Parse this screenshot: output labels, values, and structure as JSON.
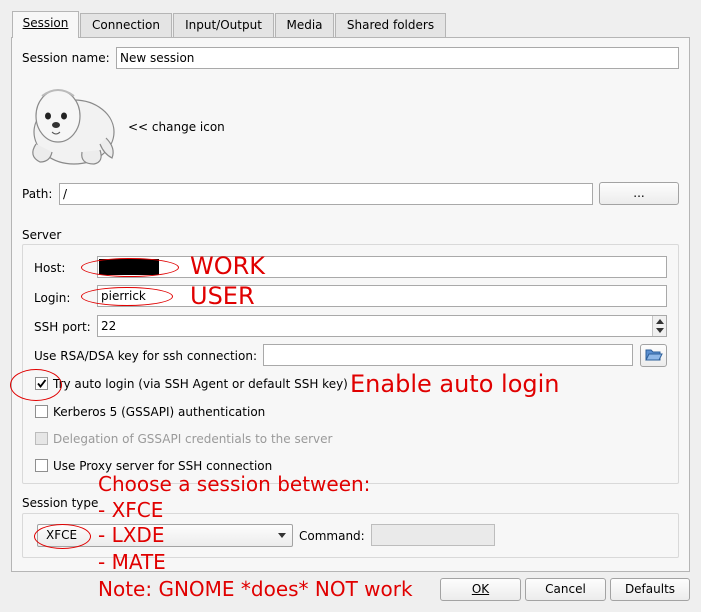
{
  "tabs": [
    "Session",
    "Connection",
    "Input/Output",
    "Media",
    "Shared folders"
  ],
  "session": {
    "name_label": "Session name:",
    "name_value": "New session",
    "change_icon": "<< change icon",
    "path_label": "Path:",
    "path_value": "/",
    "browse_label": "..."
  },
  "server": {
    "group_label": "Server",
    "host_label": "Host:",
    "host_value": "",
    "login_label": "Login:",
    "login_value": "pierrick",
    "ssh_port_label": "SSH port:",
    "ssh_port_value": "22",
    "rsa_label": "Use RSA/DSA key for ssh connection:",
    "rsa_value": "",
    "auto_login_label": "Try auto login (via SSH Agent or default SSH key)",
    "auto_login_checked": true,
    "kerberos_label": "Kerberos 5 (GSSAPI) authentication",
    "delegation_label": "Delegation of GSSAPI credentials to the server",
    "proxy_label": "Use Proxy server for SSH connection"
  },
  "session_type": {
    "group_label": "Session type",
    "selected": "XFCE",
    "command_label": "Command:",
    "command_value": ""
  },
  "buttons": {
    "ok": "OK",
    "cancel": "Cancel",
    "defaults": "Defaults"
  },
  "annotations": {
    "work": "WORK",
    "user": "USER",
    "auto_login": "Enable auto login",
    "choose": "Choose a session between:",
    "xfce": "- XFCE",
    "lxde": "- LXDE",
    "mate": "- MATE",
    "note": "Note: GNOME *does* NOT work",
    "color": "#e00000"
  },
  "icons": [
    "seal-icon",
    "folder-open-icon",
    "spin-up-icon",
    "spin-down-icon",
    "dropdown-arrow-icon",
    "checkmark-icon"
  ]
}
